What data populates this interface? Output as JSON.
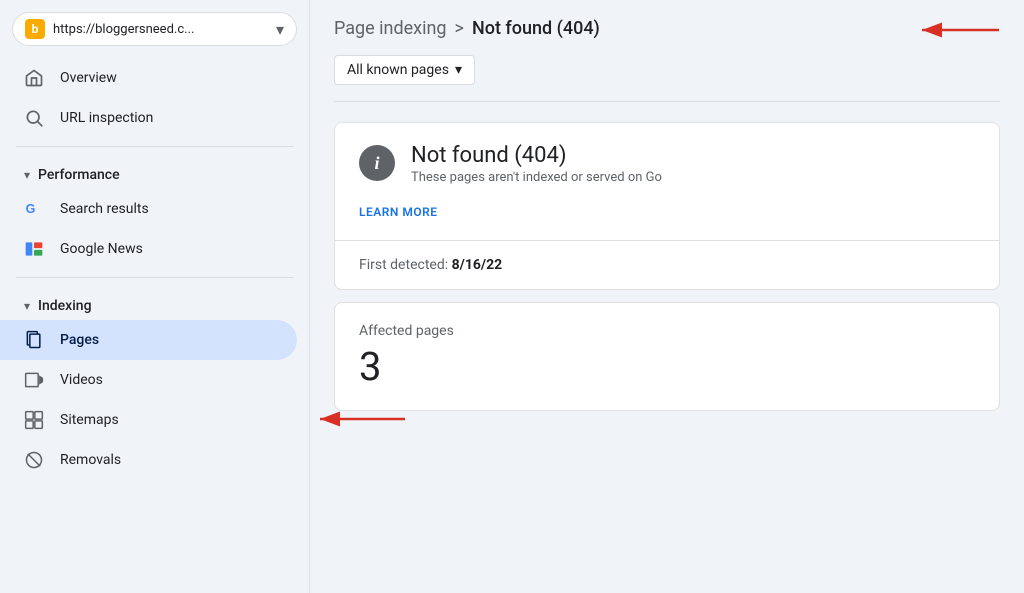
{
  "sidebar": {
    "url_bar": {
      "favicon_letter": "b",
      "url_text": "https://bloggersneed.c...",
      "dropdown_aria": "dropdown"
    },
    "nav": {
      "overview_label": "Overview",
      "url_inspection_label": "URL inspection",
      "performance_section": "Performance",
      "search_results_label": "Search results",
      "google_news_label": "Google News",
      "indexing_section": "Indexing",
      "pages_label": "Pages",
      "videos_label": "Videos",
      "sitemaps_label": "Sitemaps",
      "removals_label": "Removals"
    }
  },
  "header": {
    "breadcrumb_parent": "Page indexing",
    "breadcrumb_separator": ">",
    "breadcrumb_current": "Not found (404)"
  },
  "filter": {
    "label": "All known pages",
    "dropdown_icon": "▾"
  },
  "status_card": {
    "title": "Not found (404)",
    "description": "These pages aren't indexed or served on Go",
    "learn_more_label": "LEARN MORE"
  },
  "detected": {
    "label": "First detected:",
    "value": "8/16/22"
  },
  "affected": {
    "label": "Affected pages",
    "count": "3"
  },
  "colors": {
    "active_bg": "#d3e3fd",
    "accent": "#1a73e8",
    "arrow_red": "#d93025"
  }
}
